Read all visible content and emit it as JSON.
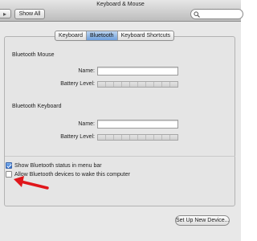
{
  "window": {
    "title": "Keyboard & Mouse"
  },
  "toolbar": {
    "show_all_label": "Show All",
    "search_value": ""
  },
  "tabs": [
    {
      "label": "Keyboard",
      "active": false
    },
    {
      "label": "Bluetooth",
      "active": true
    },
    {
      "label": "Keyboard Shortcuts",
      "active": false
    }
  ],
  "mouse_section": {
    "title": "Bluetooth Mouse",
    "name_label": "Name:",
    "name_value": "",
    "battery_label": "Battery Level:"
  },
  "keyboard_section": {
    "title": "Bluetooth Keyboard",
    "name_label": "Name:",
    "name_value": "",
    "battery_label": "Battery Level:"
  },
  "options": [
    {
      "label": "Show Bluetooth status in menu bar",
      "checked": true
    },
    {
      "label": "Allow Bluetooth devices to wake this computer",
      "checked": false
    }
  ],
  "setup_button_label": "Set Up New Device...",
  "colors": {
    "annotation_arrow": "#e0161b",
    "tab_active": "#6d9fdc"
  }
}
